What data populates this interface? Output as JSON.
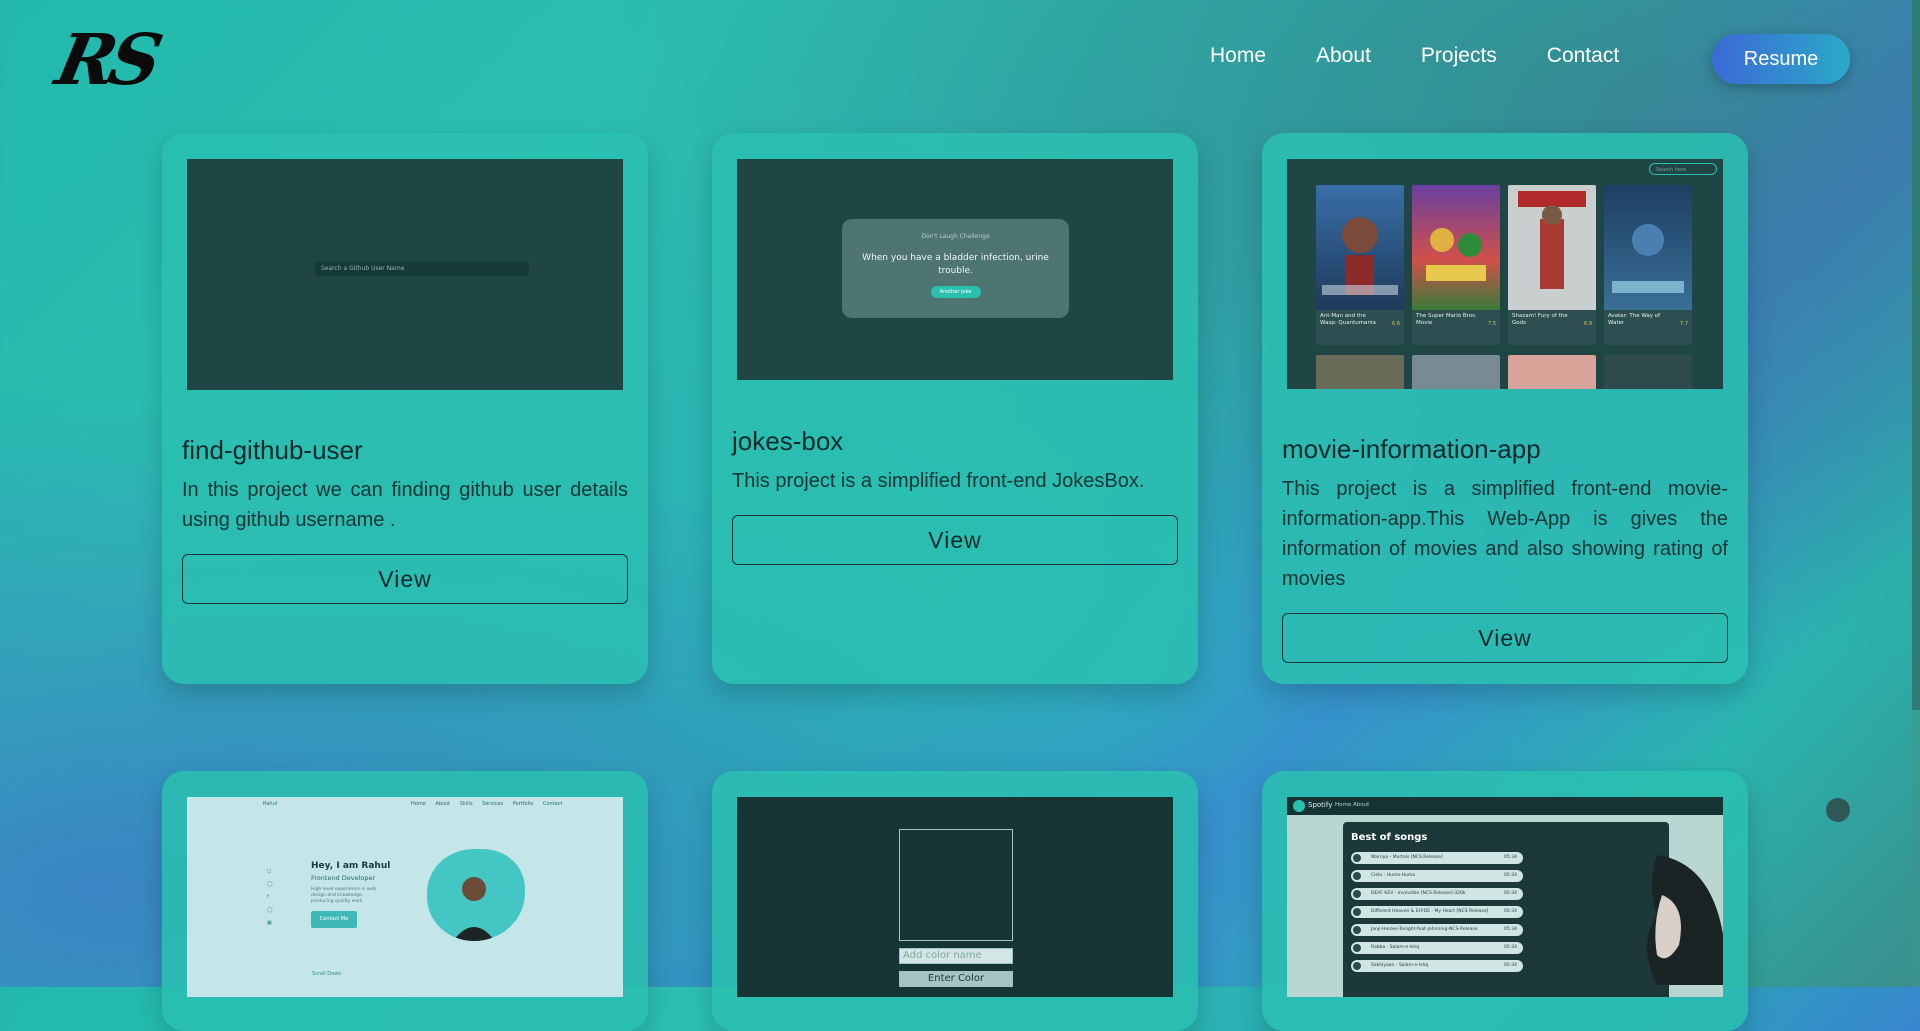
{
  "brand": {
    "logo_text": "RS"
  },
  "nav": {
    "links": [
      "Home",
      "About",
      "Projects",
      "Contact"
    ],
    "resume_label": "Resume"
  },
  "projects": [
    {
      "title": "find-github-user",
      "description": "In this project we can finding github user details using github username .",
      "button": "View",
      "preview": {
        "search_placeholder": "Search a Github User Name"
      }
    },
    {
      "title": "jokes-box",
      "description": "This project is a simplified front-end JokesBox.",
      "button": "View",
      "preview": {
        "heading": "Don't Laugh Challenge",
        "joke": "When you have a bladder infection, urine trouble.",
        "button": "Another Joke"
      }
    },
    {
      "title": "movie-information-app",
      "description": "This project is a simplified front-end movie-information-app.This Web-App is gives the information of movies and also showing rating of movies",
      "button": "View",
      "preview": {
        "search_placeholder": "Search here",
        "movies": [
          {
            "name": "Ant-Man and the Wasp: Quantumania",
            "rating": "6.6"
          },
          {
            "name": "The Super Mario Bros. Movie",
            "rating": "7.5"
          },
          {
            "name": "Shazam! Fury of the Gods",
            "rating": "6.8"
          },
          {
            "name": "Avatar: The Way of Water",
            "rating": "7.7"
          }
        ]
      }
    },
    {
      "preview": {
        "logo": "Rahul",
        "nav": "Home About Skills Services Portfolio Contact",
        "hey": "Hey, I am Rahul",
        "role": "Frontend Developer",
        "text": "High level experience in web design and knowledge, producing quality work",
        "button": "Contact Me",
        "scroll": "Scroll Down"
      }
    },
    {
      "preview": {
        "input_placeholder": "Add color name",
        "button": "Enter Color"
      }
    },
    {
      "preview": {
        "brand": "Spotify",
        "nav_home": "Home",
        "nav_about": "About",
        "title": "Best of songs",
        "songs": [
          {
            "name": "Warriyo - Mortals [NCS Release]",
            "time": "05:34"
          },
          {
            "name": "Cielo - Huma-Huma",
            "time": "05:34"
          },
          {
            "name": "DEAF KEV - Invincible [NCS Release]-320k",
            "time": "05:34"
          },
          {
            "name": "Different Heaven & EH!DE - My Heart [NCS Release]",
            "time": "05:34"
          },
          {
            "name": "Janji-Heroes-Tonight-feat-Johnning-NCS-Release",
            "time": "05:34"
          },
          {
            "name": "Rabba - Salam-e-Ishq",
            "time": "05:34"
          },
          {
            "name": "Sakhiyaan - Salam-e-Ishq",
            "time": "05:34"
          }
        ]
      }
    }
  ],
  "colors": {
    "accent": "#2bbfb0",
    "card": "#2ac0b0",
    "text_dark": "#0e2a2a"
  }
}
